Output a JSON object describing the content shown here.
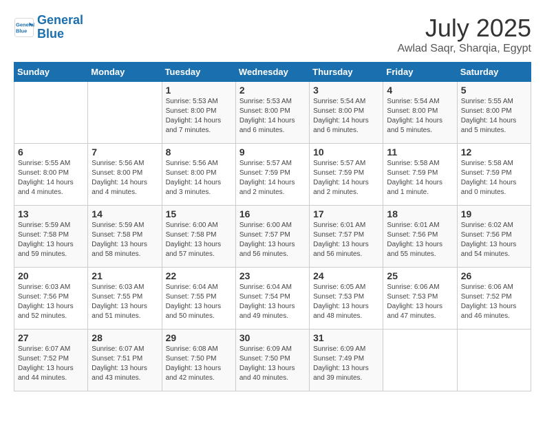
{
  "logo": {
    "line1": "General",
    "line2": "Blue"
  },
  "title": "July 2025",
  "location": "Awlad Saqr, Sharqia, Egypt",
  "weekdays": [
    "Sunday",
    "Monday",
    "Tuesday",
    "Wednesday",
    "Thursday",
    "Friday",
    "Saturday"
  ],
  "weeks": [
    [
      {
        "day": "",
        "info": ""
      },
      {
        "day": "",
        "info": ""
      },
      {
        "day": "1",
        "info": "Sunrise: 5:53 AM\nSunset: 8:00 PM\nDaylight: 14 hours\nand 7 minutes."
      },
      {
        "day": "2",
        "info": "Sunrise: 5:53 AM\nSunset: 8:00 PM\nDaylight: 14 hours\nand 6 minutes."
      },
      {
        "day": "3",
        "info": "Sunrise: 5:54 AM\nSunset: 8:00 PM\nDaylight: 14 hours\nand 6 minutes."
      },
      {
        "day": "4",
        "info": "Sunrise: 5:54 AM\nSunset: 8:00 PM\nDaylight: 14 hours\nand 5 minutes."
      },
      {
        "day": "5",
        "info": "Sunrise: 5:55 AM\nSunset: 8:00 PM\nDaylight: 14 hours\nand 5 minutes."
      }
    ],
    [
      {
        "day": "6",
        "info": "Sunrise: 5:55 AM\nSunset: 8:00 PM\nDaylight: 14 hours\nand 4 minutes."
      },
      {
        "day": "7",
        "info": "Sunrise: 5:56 AM\nSunset: 8:00 PM\nDaylight: 14 hours\nand 4 minutes."
      },
      {
        "day": "8",
        "info": "Sunrise: 5:56 AM\nSunset: 8:00 PM\nDaylight: 14 hours\nand 3 minutes."
      },
      {
        "day": "9",
        "info": "Sunrise: 5:57 AM\nSunset: 7:59 PM\nDaylight: 14 hours\nand 2 minutes."
      },
      {
        "day": "10",
        "info": "Sunrise: 5:57 AM\nSunset: 7:59 PM\nDaylight: 14 hours\nand 2 minutes."
      },
      {
        "day": "11",
        "info": "Sunrise: 5:58 AM\nSunset: 7:59 PM\nDaylight: 14 hours\nand 1 minute."
      },
      {
        "day": "12",
        "info": "Sunrise: 5:58 AM\nSunset: 7:59 PM\nDaylight: 14 hours\nand 0 minutes."
      }
    ],
    [
      {
        "day": "13",
        "info": "Sunrise: 5:59 AM\nSunset: 7:58 PM\nDaylight: 13 hours\nand 59 minutes."
      },
      {
        "day": "14",
        "info": "Sunrise: 5:59 AM\nSunset: 7:58 PM\nDaylight: 13 hours\nand 58 minutes."
      },
      {
        "day": "15",
        "info": "Sunrise: 6:00 AM\nSunset: 7:58 PM\nDaylight: 13 hours\nand 57 minutes."
      },
      {
        "day": "16",
        "info": "Sunrise: 6:00 AM\nSunset: 7:57 PM\nDaylight: 13 hours\nand 56 minutes."
      },
      {
        "day": "17",
        "info": "Sunrise: 6:01 AM\nSunset: 7:57 PM\nDaylight: 13 hours\nand 56 minutes."
      },
      {
        "day": "18",
        "info": "Sunrise: 6:01 AM\nSunset: 7:56 PM\nDaylight: 13 hours\nand 55 minutes."
      },
      {
        "day": "19",
        "info": "Sunrise: 6:02 AM\nSunset: 7:56 PM\nDaylight: 13 hours\nand 54 minutes."
      }
    ],
    [
      {
        "day": "20",
        "info": "Sunrise: 6:03 AM\nSunset: 7:56 PM\nDaylight: 13 hours\nand 52 minutes."
      },
      {
        "day": "21",
        "info": "Sunrise: 6:03 AM\nSunset: 7:55 PM\nDaylight: 13 hours\nand 51 minutes."
      },
      {
        "day": "22",
        "info": "Sunrise: 6:04 AM\nSunset: 7:55 PM\nDaylight: 13 hours\nand 50 minutes."
      },
      {
        "day": "23",
        "info": "Sunrise: 6:04 AM\nSunset: 7:54 PM\nDaylight: 13 hours\nand 49 minutes."
      },
      {
        "day": "24",
        "info": "Sunrise: 6:05 AM\nSunset: 7:53 PM\nDaylight: 13 hours\nand 48 minutes."
      },
      {
        "day": "25",
        "info": "Sunrise: 6:06 AM\nSunset: 7:53 PM\nDaylight: 13 hours\nand 47 minutes."
      },
      {
        "day": "26",
        "info": "Sunrise: 6:06 AM\nSunset: 7:52 PM\nDaylight: 13 hours\nand 46 minutes."
      }
    ],
    [
      {
        "day": "27",
        "info": "Sunrise: 6:07 AM\nSunset: 7:52 PM\nDaylight: 13 hours\nand 44 minutes."
      },
      {
        "day": "28",
        "info": "Sunrise: 6:07 AM\nSunset: 7:51 PM\nDaylight: 13 hours\nand 43 minutes."
      },
      {
        "day": "29",
        "info": "Sunrise: 6:08 AM\nSunset: 7:50 PM\nDaylight: 13 hours\nand 42 minutes."
      },
      {
        "day": "30",
        "info": "Sunrise: 6:09 AM\nSunset: 7:50 PM\nDaylight: 13 hours\nand 40 minutes."
      },
      {
        "day": "31",
        "info": "Sunrise: 6:09 AM\nSunset: 7:49 PM\nDaylight: 13 hours\nand 39 minutes."
      },
      {
        "day": "",
        "info": ""
      },
      {
        "day": "",
        "info": ""
      }
    ]
  ]
}
